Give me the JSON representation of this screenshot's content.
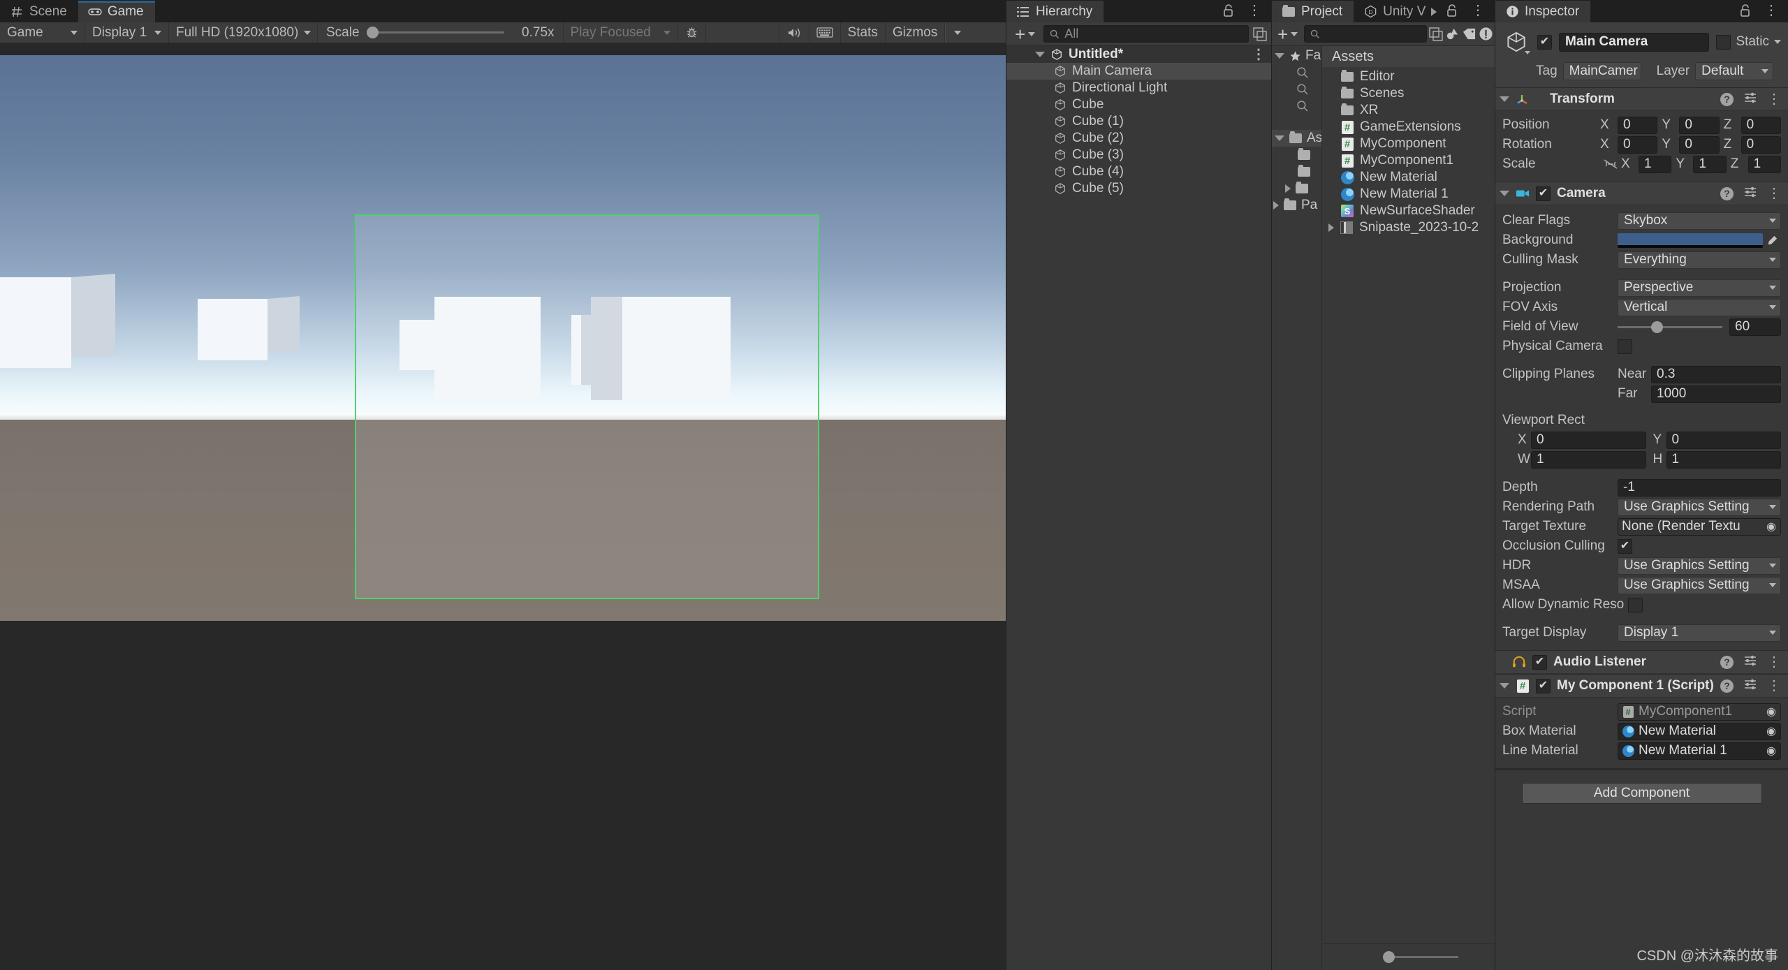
{
  "game_view": {
    "tabs": [
      {
        "label": "Scene",
        "icon": "grid-icon",
        "active": false
      },
      {
        "label": "Game",
        "icon": "gamepad-icon",
        "active": true
      }
    ],
    "toolbar": {
      "aspect_label": "Game",
      "display_label": "Display 1",
      "resolution_label": "Full HD (1920x1080)",
      "scale_label": "Scale",
      "scale_value": "0.75x",
      "play_mode_label": "Play Focused",
      "stats_label": "Stats",
      "gizmos_label": "Gizmos",
      "icons": [
        "bug-icon",
        "mute-audio-icon",
        "keyboard-icon"
      ]
    },
    "scene": {
      "sky_top_color": "#5b7295",
      "horizon_color": "#f7fcfd",
      "ground_color": "#7e756e",
      "camera_gizmo_color": "#53d06a"
    }
  },
  "hierarchy": {
    "tab_label": "Hierarchy",
    "toolbar": {
      "add_label": "+",
      "search_placeholder": "All"
    },
    "root": {
      "label": "Untitled*",
      "expanded": true
    },
    "items": [
      {
        "label": "Main Camera",
        "selected": true
      },
      {
        "label": "Directional Light",
        "selected": false
      },
      {
        "label": "Cube",
        "selected": false
      },
      {
        "label": "Cube (1)",
        "selected": false
      },
      {
        "label": "Cube (2)",
        "selected": false
      },
      {
        "label": "Cube (3)",
        "selected": false
      },
      {
        "label": "Cube (4)",
        "selected": false
      },
      {
        "label": "Cube (5)",
        "selected": false
      }
    ]
  },
  "project": {
    "tabs": [
      {
        "label": "Project",
        "active": true
      },
      {
        "label": "Unity V",
        "active": false
      }
    ],
    "toolbar": {
      "add_label": "+",
      "search_placeholder": ""
    },
    "tree": [
      {
        "label": "Fa",
        "type": "favorites",
        "expanded": true,
        "depth": 0
      },
      {
        "label": "",
        "type": "search",
        "depth": 1
      },
      {
        "label": "",
        "type": "search",
        "depth": 1
      },
      {
        "label": "",
        "type": "search",
        "depth": 1
      },
      {
        "label": "As",
        "type": "folder-open",
        "expanded": true,
        "depth": 0,
        "highlight": true
      },
      {
        "label": "",
        "type": "folder",
        "depth": 1
      },
      {
        "label": "",
        "type": "folder",
        "depth": 1
      },
      {
        "label": "",
        "type": "folder",
        "depth": 1,
        "collapsed": true
      },
      {
        "label": "Pa",
        "type": "folder",
        "depth": 0,
        "collapsed": true
      }
    ],
    "breadcrumb": "Assets",
    "assets": [
      {
        "label": "Editor",
        "type": "folder"
      },
      {
        "label": "Scenes",
        "type": "folder"
      },
      {
        "label": "XR",
        "type": "folder"
      },
      {
        "label": "GameExtensions",
        "type": "csharp"
      },
      {
        "label": "MyComponent",
        "type": "csharp"
      },
      {
        "label": "MyComponent1",
        "type": "csharp"
      },
      {
        "label": "New Material",
        "type": "material"
      },
      {
        "label": "New Material 1",
        "type": "material"
      },
      {
        "label": "NewSurfaceShader",
        "type": "shader"
      },
      {
        "label": "Snipaste_2023-10-2",
        "type": "image",
        "expandable": true
      }
    ]
  },
  "inspector": {
    "tab_label": "Inspector",
    "object": {
      "enabled": true,
      "name": "Main Camera",
      "static_label": "Static",
      "static_checked": false,
      "tag_label": "Tag",
      "tag_value": "MainCamer",
      "layer_label": "Layer",
      "layer_value": "Default"
    },
    "transform": {
      "title": "Transform",
      "position_label": "Position",
      "position": {
        "x": "0",
        "y": "0",
        "z": "0"
      },
      "rotation_label": "Rotation",
      "rotation": {
        "x": "0",
        "y": "0",
        "z": "0"
      },
      "scale_label": "Scale",
      "scale": {
        "x": "1",
        "y": "1",
        "z": "1"
      },
      "axis_x": "X",
      "axis_y": "Y",
      "axis_z": "Z"
    },
    "camera": {
      "title": "Camera",
      "enabled": true,
      "clear_flags_label": "Clear Flags",
      "clear_flags_value": "Skybox",
      "background_label": "Background",
      "background_color": "#3d5f8b",
      "culling_mask_label": "Culling Mask",
      "culling_mask_value": "Everything",
      "projection_label": "Projection",
      "projection_value": "Perspective",
      "fov_axis_label": "FOV Axis",
      "fov_axis_value": "Vertical",
      "field_of_view_label": "Field of View",
      "field_of_view_value": "60",
      "physical_camera_label": "Physical Camera",
      "physical_camera_checked": false,
      "clipping_planes_label": "Clipping Planes",
      "near_label": "Near",
      "near_value": "0.3",
      "far_label": "Far",
      "far_value": "1000",
      "viewport_rect_label": "Viewport Rect",
      "viewport": {
        "x_label": "X",
        "x": "0",
        "y_label": "Y",
        "y": "0",
        "w_label": "W",
        "w": "1",
        "h_label": "H",
        "h": "1"
      },
      "depth_label": "Depth",
      "depth_value": "-1",
      "rendering_path_label": "Rendering Path",
      "rendering_path_value": "Use Graphics Setting",
      "target_texture_label": "Target Texture",
      "target_texture_value": "None (Render Textu",
      "occlusion_culling_label": "Occlusion Culling",
      "occlusion_culling_checked": true,
      "hdr_label": "HDR",
      "hdr_value": "Use Graphics Setting",
      "msaa_label": "MSAA",
      "msaa_value": "Use Graphics Setting",
      "allow_dynamic_label": "Allow Dynamic Reso",
      "allow_dynamic_checked": false,
      "target_display_label": "Target Display",
      "target_display_value": "Display 1"
    },
    "audio_listener": {
      "title": "Audio Listener",
      "enabled": true
    },
    "my_component": {
      "title": "My Component 1 (Script)",
      "enabled": true,
      "script_label": "Script",
      "script_value": "MyComponent1",
      "box_material_label": "Box Material",
      "box_material_value": "New Material",
      "line_material_label": "Line Material",
      "line_material_value": "New Material 1"
    },
    "add_component_label": "Add Component"
  },
  "watermark": "CSDN @沐沐森的故事"
}
